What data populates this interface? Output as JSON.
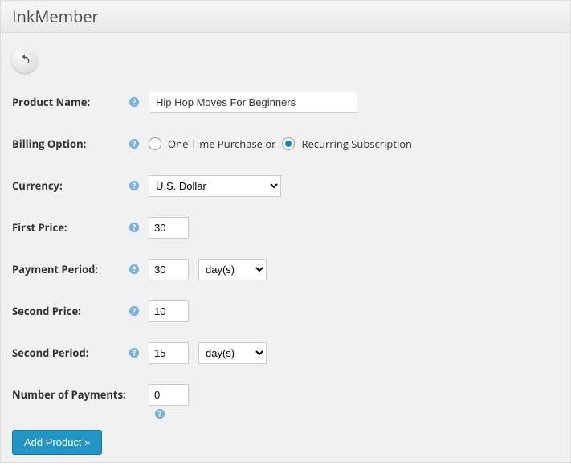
{
  "header": {
    "title": "InkMember"
  },
  "form": {
    "product_name": {
      "label": "Product Name:",
      "value": "Hip Hop Moves For Beginners"
    },
    "billing_option": {
      "label": "Billing Option:",
      "one_time_label": "One Time Purchase or",
      "recurring_label": "Recurring Subscription"
    },
    "currency": {
      "label": "Currency:",
      "value": "U.S. Dollar"
    },
    "first_price": {
      "label": "First Price:",
      "value": "30"
    },
    "payment_period": {
      "label": "Payment Period:",
      "value": "30",
      "unit": "day(s)"
    },
    "second_price": {
      "label": "Second Price:",
      "value": "10"
    },
    "second_period": {
      "label": "Second Period:",
      "value": "15",
      "unit": "day(s)"
    },
    "num_payments": {
      "label": "Number of Payments:",
      "value": "0"
    },
    "submit_label": "Add Product »"
  }
}
